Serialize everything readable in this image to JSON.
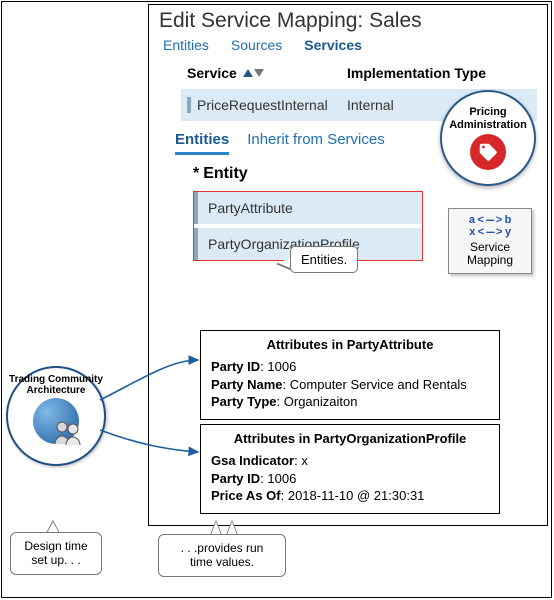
{
  "header": {
    "title": "Edit Service Mapping: Sales"
  },
  "top_tabs": {
    "entities": "Entities",
    "sources": "Sources",
    "services": "Services"
  },
  "service_table": {
    "col_service": "Service",
    "col_impl": "Implementation Type",
    "row": {
      "service": "PriceRequestInternal",
      "impl": "Internal"
    }
  },
  "sub_tabs": {
    "entities": "Entities",
    "inherit": "Inherit from Services"
  },
  "entity_heading": {
    "asterisk": "*",
    "label": "Entity"
  },
  "entities_list": [
    "PartyAttribute",
    "PartyOrganizationProfile"
  ],
  "entities_callout": "Entities.",
  "pricing_badge": "Pricing Administration",
  "service_mapping_tile": {
    "line1_a": "a",
    "line1_b": "b",
    "line2_a": "x",
    "line2_b": "y",
    "label": "Service Mapping"
  },
  "attr_box_1": {
    "title": "Attributes in PartyAttribute",
    "party_id_label": "Party ID",
    "party_id_val": "1006",
    "party_name_label": "Party Name",
    "party_name_val": "Computer Service and Rentals",
    "party_type_label": "Party Type",
    "party_type_val": "Organizaiton"
  },
  "attr_box_2": {
    "title": "Attributes in PartyOrganizationProfile",
    "gsa_label": "Gsa Indicator",
    "gsa_val": "x",
    "party_id_label": "Party ID",
    "party_id_val": "1006",
    "price_asof_label": "Price As Of",
    "price_asof_val": "2018-11-10 @ 21:30:31"
  },
  "tca_badge": "Trading Community Architecture",
  "speech1": "Design time set up. . .",
  "speech2": ". . .provides run time values."
}
